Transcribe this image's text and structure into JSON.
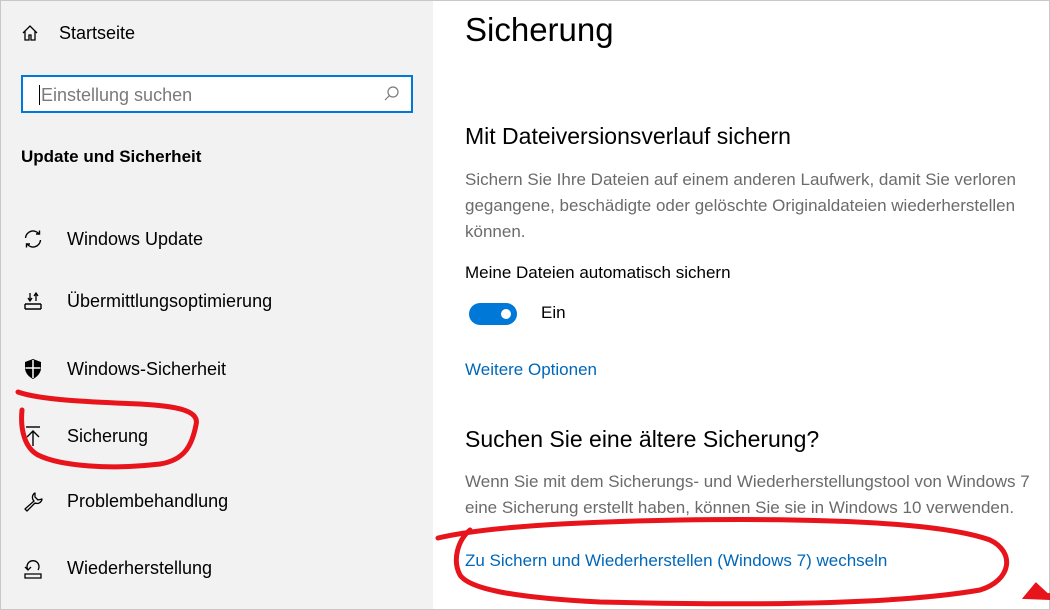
{
  "sidebar": {
    "home_label": "Startseite",
    "search_placeholder": "Einstellung suchen",
    "section_title": "Update und Sicherheit",
    "items": [
      {
        "label": "Windows Update",
        "icon": "refresh-icon"
      },
      {
        "label": "Übermittlungsoptimierung",
        "icon": "delivery-optimization-icon"
      },
      {
        "label": "Windows-Sicherheit",
        "icon": "shield-icon"
      },
      {
        "label": "Sicherung",
        "icon": "upload-arrow-icon"
      },
      {
        "label": "Problembehandlung",
        "icon": "wrench-icon"
      },
      {
        "label": "Wiederherstellung",
        "icon": "recovery-icon"
      }
    ]
  },
  "main": {
    "page_title": "Sicherung",
    "file_history": {
      "heading": "Mit Dateiversionsverlauf sichern",
      "description": "Sichern Sie Ihre Dateien auf einem anderen Laufwerk, damit Sie verloren gegangene, beschädigte oder gelöschte Originaldateien wiederherstellen können.",
      "toggle_label": "Meine Dateien automatisch sichern",
      "toggle_state": "Ein",
      "more_options_link": "Weitere Optionen"
    },
    "older_backup": {
      "heading": "Suchen Sie eine ältere Sicherung?",
      "description": "Wenn Sie mit dem Sicherungs- und Wiederherstellungstool von Windows 7 eine Sicherung erstellt haben, können Sie sie in Windows 10 verwenden.",
      "link": "Zu Sichern und Wiederherstellen (Windows 7) wechseln"
    }
  },
  "colors": {
    "accent": "#0078d7",
    "link": "#0067b8",
    "annotation": "#e8141b",
    "sidebar_bg": "#f2f2f2"
  }
}
